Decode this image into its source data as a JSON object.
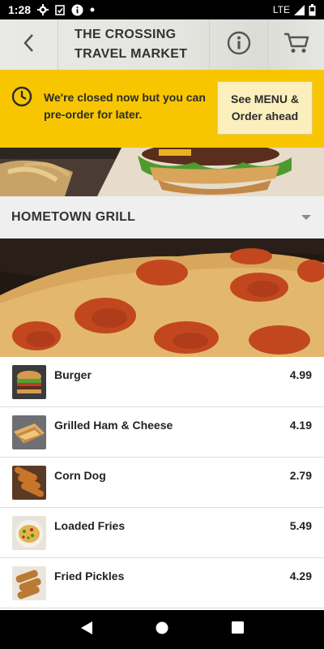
{
  "status_bar": {
    "time": "1:28",
    "network": "LTE"
  },
  "header": {
    "title_line1": "THE CROSSING",
    "title_line2": "TRAVEL MARKET",
    "icons": {
      "back": "back-arrow-icon",
      "info": "info-icon",
      "cart": "cart-icon"
    }
  },
  "banner": {
    "message": "We're closed now but you can pre-order for later.",
    "button_line1": "See MENU &",
    "button_line2": "Order ahead"
  },
  "category": {
    "label": "HOMETOWN GRILL"
  },
  "menu_items": [
    {
      "name": "Burger",
      "price": "4.99"
    },
    {
      "name": "Grilled Ham & Cheese",
      "price": "4.19"
    },
    {
      "name": "Corn Dog",
      "price": "2.79"
    },
    {
      "name": "Loaded Fries",
      "price": "5.49"
    },
    {
      "name": "Fried Pickles",
      "price": "4.29"
    }
  ],
  "colors": {
    "banner": "#f7c600",
    "button": "#fbefbe",
    "category_bg": "#efefef"
  }
}
